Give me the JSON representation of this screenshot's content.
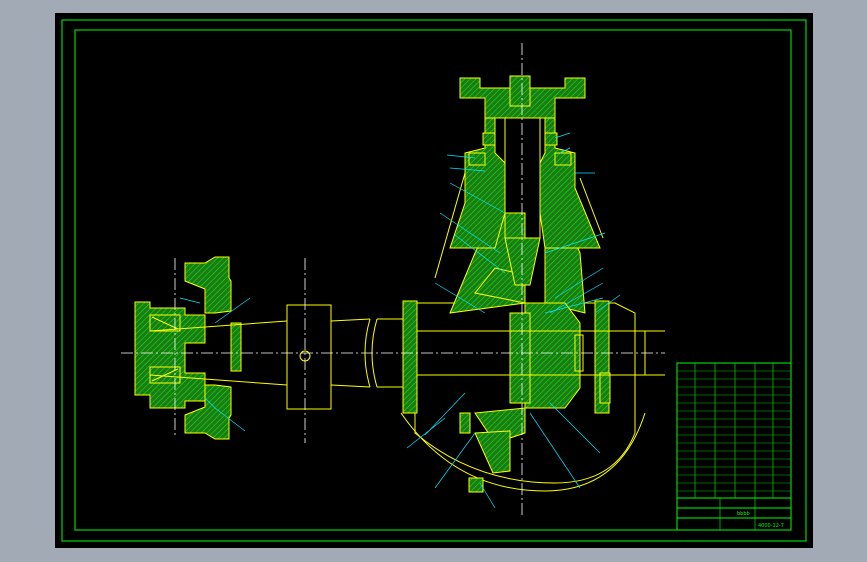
{
  "drawing": {
    "title_block_code": "4000-12-7",
    "title_block_small": "bbbb",
    "title_block_sign": "",
    "colors": {
      "background": "#000000",
      "frame": "#00ff00",
      "part_fill": "#1e7a16",
      "section_line": "#00ff00",
      "outline": "#ffff00",
      "centerline": "#ffffff",
      "leader": "#00e5ff",
      "viewport_border": "#a2aab6"
    }
  }
}
